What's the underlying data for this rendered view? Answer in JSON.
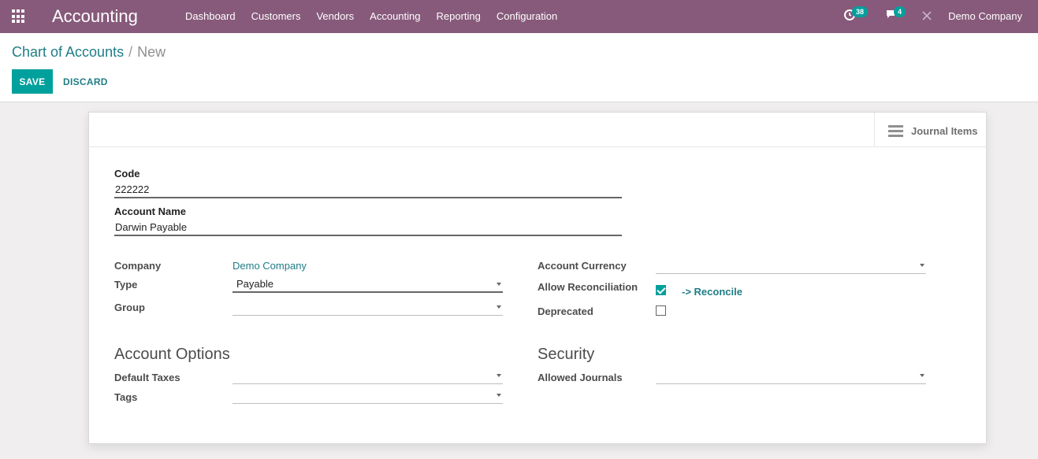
{
  "navbar": {
    "app_title": "Accounting",
    "menu": [
      "Dashboard",
      "Customers",
      "Vendors",
      "Accounting",
      "Reporting",
      "Configuration"
    ],
    "activity_count": "38",
    "message_count": "4",
    "company": "Demo Company"
  },
  "breadcrumb": {
    "parent": "Chart of Accounts",
    "separator": "/",
    "current": "New"
  },
  "buttons": {
    "save": "SAVE",
    "discard": "DISCARD"
  },
  "smart_button": {
    "label": "Journal Items"
  },
  "form": {
    "code_label": "Code",
    "code_value": "222222",
    "name_label": "Account Name",
    "name_value": "Darwin Payable",
    "company_label": "Company",
    "company_value": "Demo Company",
    "type_label": "Type",
    "type_value": "Payable",
    "group_label": "Group",
    "group_value": "",
    "currency_label": "Account Currency",
    "currency_value": "",
    "reconcile_label": "Allow Reconciliation",
    "reconcile_checked": true,
    "reconcile_link": "-> Reconcile",
    "deprecated_label": "Deprecated",
    "deprecated_checked": false,
    "options_title": "Account Options",
    "taxes_label": "Default Taxes",
    "tags_label": "Tags",
    "security_title": "Security",
    "journals_label": "Allowed Journals"
  },
  "colors": {
    "navbar": "#875a7b",
    "primary": "#00a09d",
    "link": "#1f7d86"
  }
}
